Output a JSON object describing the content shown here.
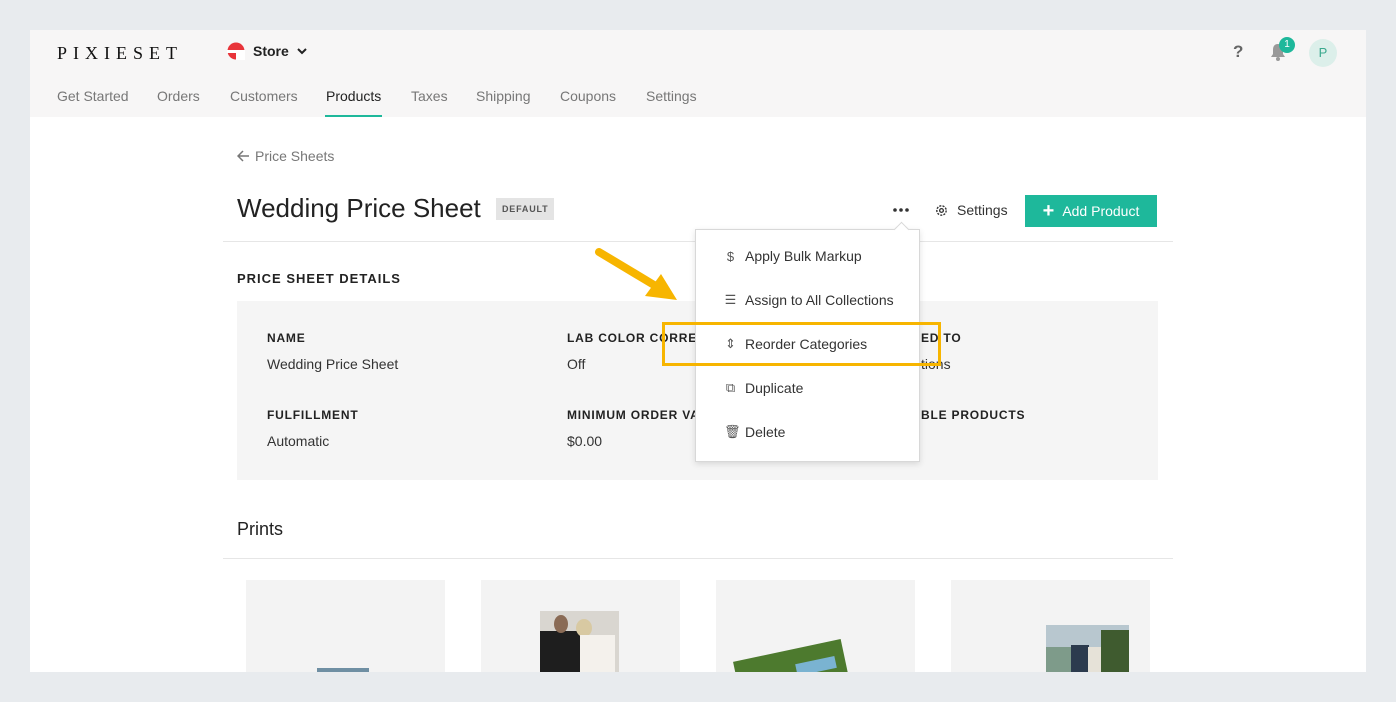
{
  "brand": "PIXIESET",
  "store": {
    "label": "Store"
  },
  "header": {
    "help_glyph": "?",
    "notification_count": "1",
    "avatar_initial": "P"
  },
  "nav": {
    "items": [
      "Get Started",
      "Orders",
      "Customers",
      "Products",
      "Taxes",
      "Shipping",
      "Coupons",
      "Settings"
    ],
    "active": "Products"
  },
  "breadcrumb": "Price Sheets",
  "page": {
    "title": "Wedding Price Sheet",
    "badge": "DEFAULT",
    "settings_label": "Settings",
    "add_label": "Add Product"
  },
  "details": {
    "section_title": "PRICE SHEET DETAILS",
    "fields": [
      {
        "label": "NAME",
        "value": "Wedding Price Sheet"
      },
      {
        "label": "LAB COLOR CORREC",
        "value": "Off"
      },
      {
        "label": "ED TO",
        "value": "tions"
      },
      {
        "label": "FULFILLMENT",
        "value": "Automatic"
      },
      {
        "label": "MINIMUM ORDER VA",
        "value": "$0.00"
      },
      {
        "label": "BLE PRODUCTS",
        "value": ""
      }
    ]
  },
  "prints": {
    "title": "Prints"
  },
  "menu": {
    "items": [
      {
        "icon": "$",
        "label": "Apply Bulk Markup"
      },
      {
        "icon": "☰",
        "label": "Assign to All Collections"
      },
      {
        "icon": "⇕",
        "label": "Reorder Categories"
      },
      {
        "icon": "⧉",
        "label": "Duplicate"
      },
      {
        "icon": "🗑",
        "label": "Delete"
      }
    ],
    "highlighted": "Reorder Categories"
  },
  "colors": {
    "accent": "#1eb89b",
    "annotation": "#f7b500",
    "brand_red": "#e8343a"
  }
}
